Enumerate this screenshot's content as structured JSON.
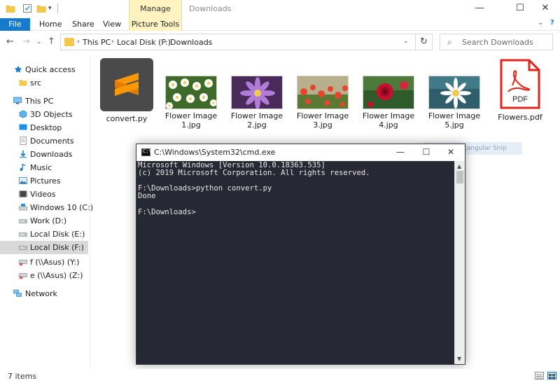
{
  "window": {
    "title": "Downloads",
    "manage_tab": "Manage",
    "controls": {
      "minimize": "—",
      "maximize": "☐",
      "close": "✕"
    }
  },
  "ribbon": {
    "tabs": [
      "File",
      "Home",
      "Share",
      "View"
    ],
    "picture_tools": "Picture Tools",
    "expand": "⌄",
    "help": "?"
  },
  "address": {
    "back": "←",
    "forward": "→",
    "history": "⌄",
    "up": "↑",
    "crumbs": [
      "This PC",
      "Local Disk (F:)",
      "Downloads"
    ],
    "separator": "›",
    "dropdown": "⌄",
    "refresh": "↻"
  },
  "search": {
    "placeholder": "Search Downloads",
    "icon": "search-icon"
  },
  "sidebar": {
    "items": [
      {
        "label": "Quick access",
        "icon": "star-icon"
      },
      {
        "label": "src",
        "icon": "folder-icon"
      },
      {
        "label": "This PC",
        "icon": "computer-icon"
      },
      {
        "label": "3D Objects",
        "icon": "cube-icon"
      },
      {
        "label": "Desktop",
        "icon": "desktop-icon"
      },
      {
        "label": "Documents",
        "icon": "documents-icon"
      },
      {
        "label": "Downloads",
        "icon": "download-icon"
      },
      {
        "label": "Music",
        "icon": "music-icon"
      },
      {
        "label": "Pictures",
        "icon": "pictures-icon"
      },
      {
        "label": "Videos",
        "icon": "videos-icon"
      },
      {
        "label": "Windows 10 (C:)",
        "icon": "drive-icon"
      },
      {
        "label": "Work (D:)",
        "icon": "drive-icon"
      },
      {
        "label": "Local Disk (E:)",
        "icon": "drive-icon"
      },
      {
        "label": "Local Disk (F:)",
        "icon": "drive-icon"
      },
      {
        "label": "f (\\\\Asus) (Y:)",
        "icon": "network-drive-icon"
      },
      {
        "label": "e (\\\\Asus) (Z:)",
        "icon": "network-drive-icon"
      },
      {
        "label": "Network",
        "icon": "network-icon"
      }
    ],
    "selected": "Local Disk (F:)"
  },
  "files": [
    {
      "name": "convert.py",
      "type": "sublime"
    },
    {
      "name": "Flower Image 1.jpg",
      "line1": "Flower Image",
      "line2": "1.jpg",
      "type": "image"
    },
    {
      "name": "Flower Image 2.jpg",
      "line1": "Flower Image",
      "line2": "2.jpg",
      "type": "image"
    },
    {
      "name": "Flower Image 3.jpg",
      "line1": "Flower Image",
      "line2": "3.jpg",
      "type": "image"
    },
    {
      "name": "Flower Image 4.jpg",
      "line1": "Flower Image",
      "line2": "4.jpg",
      "type": "image"
    },
    {
      "name": "Flower Image 5.jpg",
      "line1": "Flower Image",
      "line2": "5.jpg",
      "type": "image"
    },
    {
      "name": "Flowers.pdf",
      "type": "pdf",
      "badge": "PDF"
    }
  ],
  "snip_hint": "Rectangular Snip",
  "cmd": {
    "title": "C:\\Windows\\System32\\cmd.exe",
    "icon_text": "C:\\",
    "controls": {
      "minimize": "—",
      "maximize": "☐",
      "close": "✕"
    },
    "lines": [
      "Microsoft Windows [Version 10.0.18363.535]",
      "(c) 2019 Microsoft Corporation. All rights reserved.",
      "",
      "F:\\Downloads>python convert.py",
      "Done",
      "",
      "F:\\Downloads>"
    ]
  },
  "status": {
    "items": "7 items"
  },
  "colors": {
    "accent": "#1979ca",
    "manage_tab": "#fff4c1",
    "cmd_bg": "#262833",
    "selection": "#d9d9d9",
    "pdf_red": "#e1251b",
    "sublime_orange": "#ff9800"
  }
}
